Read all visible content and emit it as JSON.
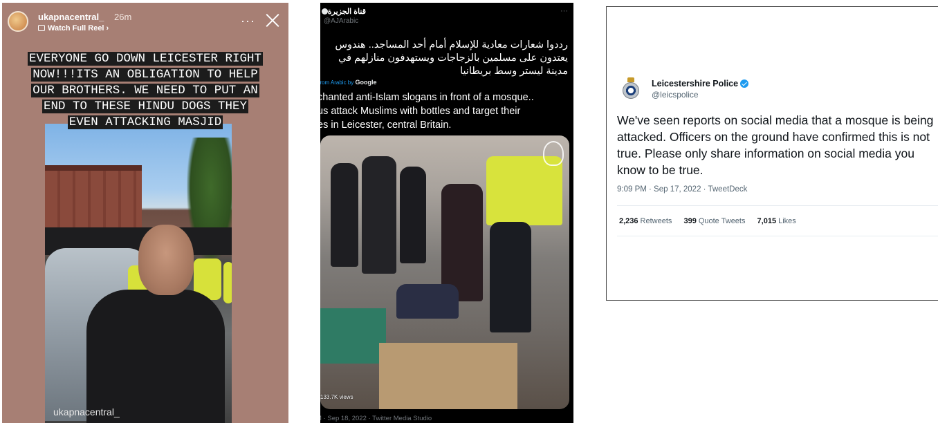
{
  "instagram_story": {
    "username": "ukapnacentral_",
    "time_ago": "26m",
    "watch_full_reel": "Watch Full Reel ›",
    "more": "···",
    "caption_lines": [
      "EVERYONE GO DOWN LEICESTER RIGHT",
      "NOW!!!ITS AN OBLIGATION TO HELP",
      "OUR BROTHERS. WE NEED TO PUT AN",
      "END TO THESE HINDU DOGS THEY",
      "EVEN ATTACKING MASJID"
    ],
    "watermark": "ukapnacentral_",
    "icons": [
      "close-icon",
      "reel-icon",
      "more-icon"
    ]
  },
  "aljazeera_tweet": {
    "name": "قناة الجزيرة",
    "handle": "@AJArabic",
    "more": "···",
    "arabic_lines": [
      "رددوا شعارات معادية للإسلام أمام أحد المساجد.. هندوس",
      "يعتدون على مسلمين بالزجاجات ويستهدفون منازلهم في",
      "مدينة ليستر وسط بريطانيا"
    ],
    "translated_from": "ed from Arabic by",
    "translator": "Google",
    "english_lines": [
      "chanted anti-Islam slogans in front of a mosque..",
      "us attack Muslims with bottles and target their",
      "es in Leicester, central Britain."
    ],
    "views": "133.7K views",
    "footer": "M · Sep 18, 2022 · Twitter Media Studio"
  },
  "police_tweet": {
    "name": "Leicestershire Police",
    "handle": "@leicspolice",
    "more": "···",
    "text": "We've seen reports on social media that a mosque is being attacked. Officers on the ground have confirmed this is not true. Please only share information on social media you know to be true.",
    "meta": "9:09 PM · Sep 17, 2022 · TweetDeck",
    "stats": [
      {
        "value": "2,236",
        "label": "Retweets"
      },
      {
        "value": "399",
        "label": "Quote Tweets"
      },
      {
        "value": "7,015",
        "label": "Likes"
      }
    ]
  },
  "colors": {
    "story_bg": "#a77f74",
    "caption_bg": "#1c1c1c",
    "aj_bg": "#000000",
    "twitter_blue": "#1d9bf0",
    "police_border": "#4b4b4b"
  }
}
